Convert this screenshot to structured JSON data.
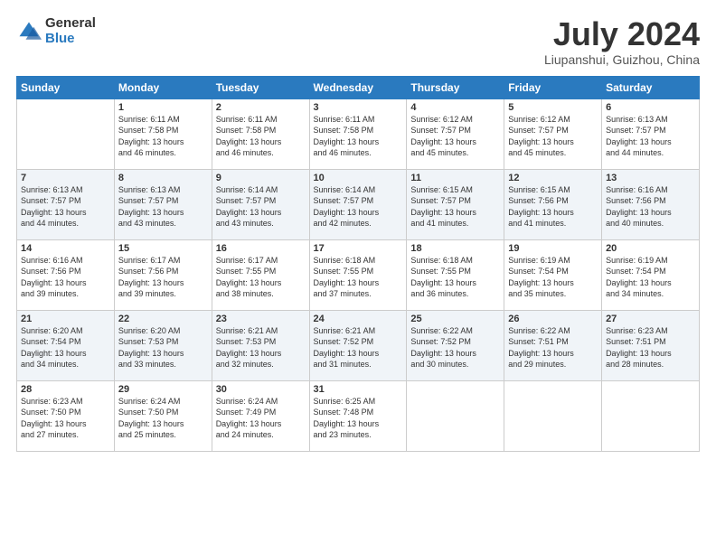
{
  "header": {
    "logo_general": "General",
    "logo_blue": "Blue",
    "title": "July 2024",
    "location": "Liupanshui, Guizhou, China"
  },
  "days_of_week": [
    "Sunday",
    "Monday",
    "Tuesday",
    "Wednesday",
    "Thursday",
    "Friday",
    "Saturday"
  ],
  "weeks": [
    [
      {
        "day": "",
        "info": ""
      },
      {
        "day": "1",
        "info": "Sunrise: 6:11 AM\nSunset: 7:58 PM\nDaylight: 13 hours\nand 46 minutes."
      },
      {
        "day": "2",
        "info": "Sunrise: 6:11 AM\nSunset: 7:58 PM\nDaylight: 13 hours\nand 46 minutes."
      },
      {
        "day": "3",
        "info": "Sunrise: 6:11 AM\nSunset: 7:58 PM\nDaylight: 13 hours\nand 46 minutes."
      },
      {
        "day": "4",
        "info": "Sunrise: 6:12 AM\nSunset: 7:57 PM\nDaylight: 13 hours\nand 45 minutes."
      },
      {
        "day": "5",
        "info": "Sunrise: 6:12 AM\nSunset: 7:57 PM\nDaylight: 13 hours\nand 45 minutes."
      },
      {
        "day": "6",
        "info": "Sunrise: 6:13 AM\nSunset: 7:57 PM\nDaylight: 13 hours\nand 44 minutes."
      }
    ],
    [
      {
        "day": "7",
        "info": "Sunrise: 6:13 AM\nSunset: 7:57 PM\nDaylight: 13 hours\nand 44 minutes."
      },
      {
        "day": "8",
        "info": "Sunrise: 6:13 AM\nSunset: 7:57 PM\nDaylight: 13 hours\nand 43 minutes."
      },
      {
        "day": "9",
        "info": "Sunrise: 6:14 AM\nSunset: 7:57 PM\nDaylight: 13 hours\nand 43 minutes."
      },
      {
        "day": "10",
        "info": "Sunrise: 6:14 AM\nSunset: 7:57 PM\nDaylight: 13 hours\nand 42 minutes."
      },
      {
        "day": "11",
        "info": "Sunrise: 6:15 AM\nSunset: 7:57 PM\nDaylight: 13 hours\nand 41 minutes."
      },
      {
        "day": "12",
        "info": "Sunrise: 6:15 AM\nSunset: 7:56 PM\nDaylight: 13 hours\nand 41 minutes."
      },
      {
        "day": "13",
        "info": "Sunrise: 6:16 AM\nSunset: 7:56 PM\nDaylight: 13 hours\nand 40 minutes."
      }
    ],
    [
      {
        "day": "14",
        "info": "Sunrise: 6:16 AM\nSunset: 7:56 PM\nDaylight: 13 hours\nand 39 minutes."
      },
      {
        "day": "15",
        "info": "Sunrise: 6:17 AM\nSunset: 7:56 PM\nDaylight: 13 hours\nand 39 minutes."
      },
      {
        "day": "16",
        "info": "Sunrise: 6:17 AM\nSunset: 7:55 PM\nDaylight: 13 hours\nand 38 minutes."
      },
      {
        "day": "17",
        "info": "Sunrise: 6:18 AM\nSunset: 7:55 PM\nDaylight: 13 hours\nand 37 minutes."
      },
      {
        "day": "18",
        "info": "Sunrise: 6:18 AM\nSunset: 7:55 PM\nDaylight: 13 hours\nand 36 minutes."
      },
      {
        "day": "19",
        "info": "Sunrise: 6:19 AM\nSunset: 7:54 PM\nDaylight: 13 hours\nand 35 minutes."
      },
      {
        "day": "20",
        "info": "Sunrise: 6:19 AM\nSunset: 7:54 PM\nDaylight: 13 hours\nand 34 minutes."
      }
    ],
    [
      {
        "day": "21",
        "info": "Sunrise: 6:20 AM\nSunset: 7:54 PM\nDaylight: 13 hours\nand 34 minutes."
      },
      {
        "day": "22",
        "info": "Sunrise: 6:20 AM\nSunset: 7:53 PM\nDaylight: 13 hours\nand 33 minutes."
      },
      {
        "day": "23",
        "info": "Sunrise: 6:21 AM\nSunset: 7:53 PM\nDaylight: 13 hours\nand 32 minutes."
      },
      {
        "day": "24",
        "info": "Sunrise: 6:21 AM\nSunset: 7:52 PM\nDaylight: 13 hours\nand 31 minutes."
      },
      {
        "day": "25",
        "info": "Sunrise: 6:22 AM\nSunset: 7:52 PM\nDaylight: 13 hours\nand 30 minutes."
      },
      {
        "day": "26",
        "info": "Sunrise: 6:22 AM\nSunset: 7:51 PM\nDaylight: 13 hours\nand 29 minutes."
      },
      {
        "day": "27",
        "info": "Sunrise: 6:23 AM\nSunset: 7:51 PM\nDaylight: 13 hours\nand 28 minutes."
      }
    ],
    [
      {
        "day": "28",
        "info": "Sunrise: 6:23 AM\nSunset: 7:50 PM\nDaylight: 13 hours\nand 27 minutes."
      },
      {
        "day": "29",
        "info": "Sunrise: 6:24 AM\nSunset: 7:50 PM\nDaylight: 13 hours\nand 25 minutes."
      },
      {
        "day": "30",
        "info": "Sunrise: 6:24 AM\nSunset: 7:49 PM\nDaylight: 13 hours\nand 24 minutes."
      },
      {
        "day": "31",
        "info": "Sunrise: 6:25 AM\nSunset: 7:48 PM\nDaylight: 13 hours\nand 23 minutes."
      },
      {
        "day": "",
        "info": ""
      },
      {
        "day": "",
        "info": ""
      },
      {
        "day": "",
        "info": ""
      }
    ]
  ]
}
